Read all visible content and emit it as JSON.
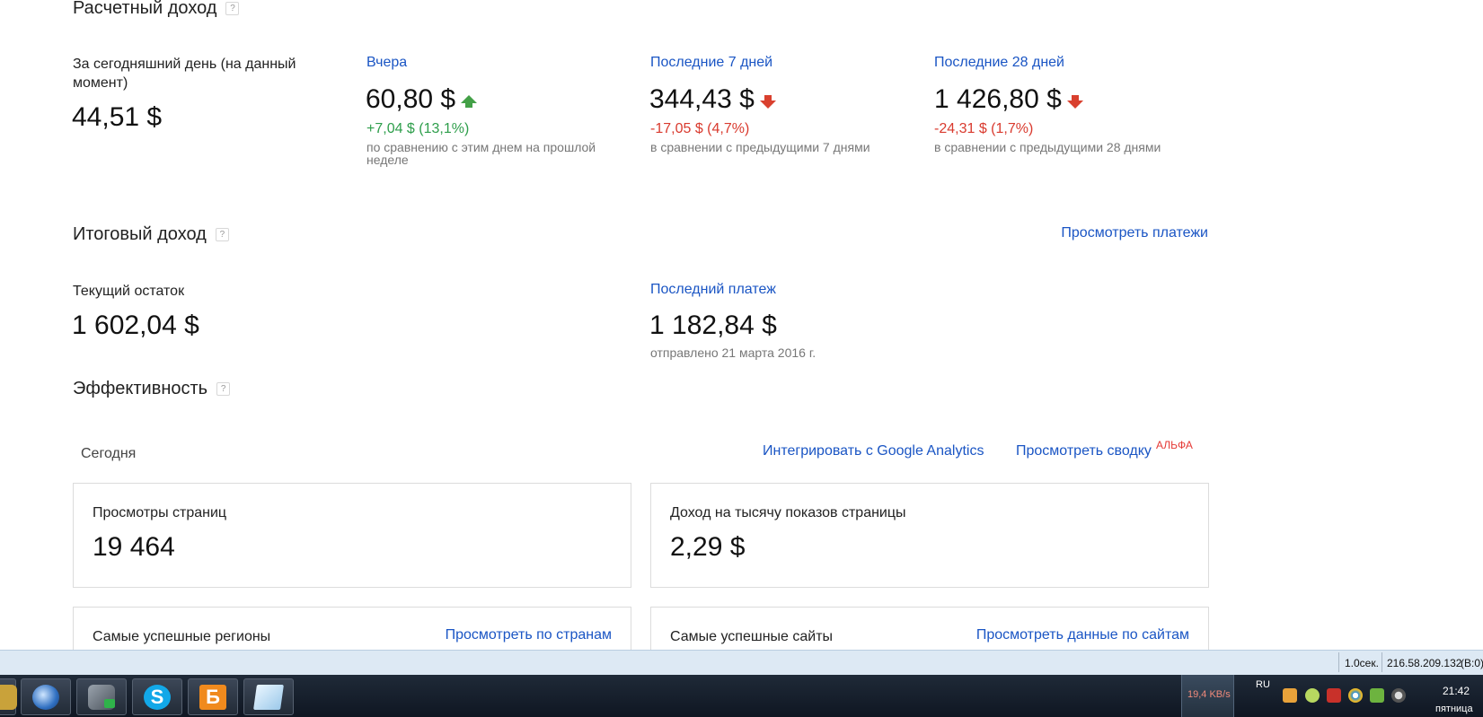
{
  "estimated": {
    "title": "Расчетный доход",
    "help": "?",
    "today": {
      "label": "За сегодняшний день (на данный момент)",
      "value": "44,51 $"
    },
    "yesterday": {
      "label": "Вчера",
      "value": "60,80 $",
      "trend": "up",
      "change": "+7,04 $ (13,1%)",
      "note": "по сравнению с этим днем на прошлой неделе"
    },
    "last7": {
      "label": "Последние 7 дней",
      "value": "344,43 $",
      "trend": "down",
      "change": "-17,05 $ (4,7%)",
      "note": "в сравнении с предыдущими 7 днями"
    },
    "last28": {
      "label": "Последние 28 дней",
      "value": "1 426,80 $",
      "trend": "down",
      "change": "-24,31 $ (1,7%)",
      "note": "в сравнении с предыдущими 28 днями"
    }
  },
  "final": {
    "title": "Итоговый доход",
    "help": "?",
    "view_payments": "Просмотреть платежи",
    "balance": {
      "label": "Текущий остаток",
      "value": "1 602,04 $"
    },
    "last_payment": {
      "label": "Последний платеж",
      "value": "1 182,84 $",
      "note": "отправлено 21 марта 2016 г."
    }
  },
  "performance": {
    "title": "Эффективность",
    "help": "?",
    "period": "Сегодня",
    "integrate_link": "Интегрировать с Google Analytics",
    "summary_link": "Просмотреть сводку",
    "alpha_badge": "АЛЬФА",
    "pageviews": {
      "label": "Просмотры страниц",
      "value": "19 464"
    },
    "rpm": {
      "label": "Доход на тысячу показов страницы",
      "value": "2,29 $"
    },
    "top_regions": {
      "label": "Самые успешные регионы",
      "link": "Просмотреть по странам"
    },
    "top_sites": {
      "label": "Самые успешные сайты",
      "link": "Просмотреть данные по сайтам"
    }
  },
  "statusbar": {
    "time_taken": "1.0сек.",
    "ip": "216.58.209.132",
    "suffix": "(B:0)"
  },
  "taskbar": {
    "apps": [
      "thunderbird-icon",
      "network-transfer-icon",
      "skype-icon",
      "b-app-icon",
      "notepad-icon"
    ],
    "net_speed": "19,4 KB/s",
    "lang": "RU",
    "time": "21:42",
    "day": "пятница"
  },
  "colors": {
    "link": "#1a55c4",
    "positive": "#2e9e4b",
    "negative": "#d93a2e",
    "alpha": "#e53935"
  }
}
